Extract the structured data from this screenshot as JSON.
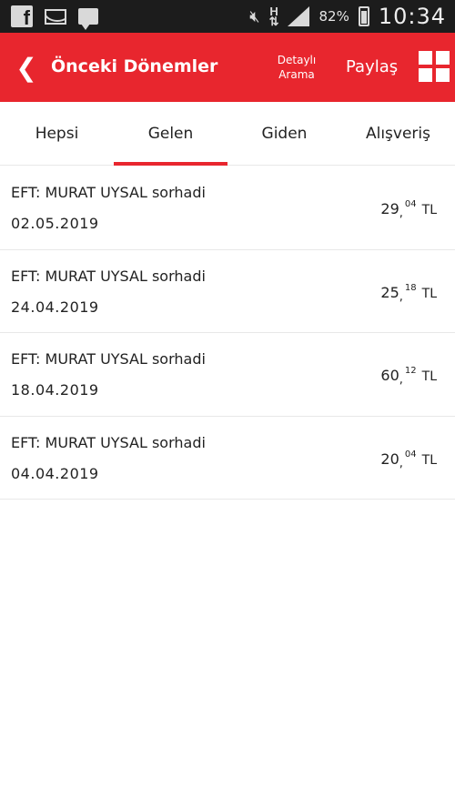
{
  "status_bar": {
    "battery": "82%",
    "network": "H",
    "time": "10:34"
  },
  "header": {
    "back_icon": "chevron-left-icon",
    "title": "Önceki Dönemler",
    "detailed_search_line1": "Detaylı",
    "detailed_search_line2": "Arama",
    "share_label": "Paylaş",
    "grid_icon": "grid-icon",
    "accent_color": "#e8262e"
  },
  "tabs": [
    {
      "label": "Hepsi",
      "active": false
    },
    {
      "label": "Gelen",
      "active": true
    },
    {
      "label": "Giden",
      "active": false
    },
    {
      "label": "Alışveriş",
      "active": false
    }
  ],
  "transactions": [
    {
      "description": "EFT: MURAT UYSAL sorhadi",
      "date": "02.05.2019",
      "amount_int": "29",
      "amount_dec": "04",
      "currency": "TL"
    },
    {
      "description": "EFT: MURAT UYSAL sorhadi",
      "date": "24.04.2019",
      "amount_int": "25",
      "amount_dec": "18",
      "currency": "TL"
    },
    {
      "description": "EFT: MURAT UYSAL sorhadi",
      "date": "18.04.2019",
      "amount_int": "60",
      "amount_dec": "12",
      "currency": "TL"
    },
    {
      "description": "EFT: MURAT UYSAL sorhadi",
      "date": "04.04.2019",
      "amount_int": "20",
      "amount_dec": "04",
      "currency": "TL"
    }
  ]
}
